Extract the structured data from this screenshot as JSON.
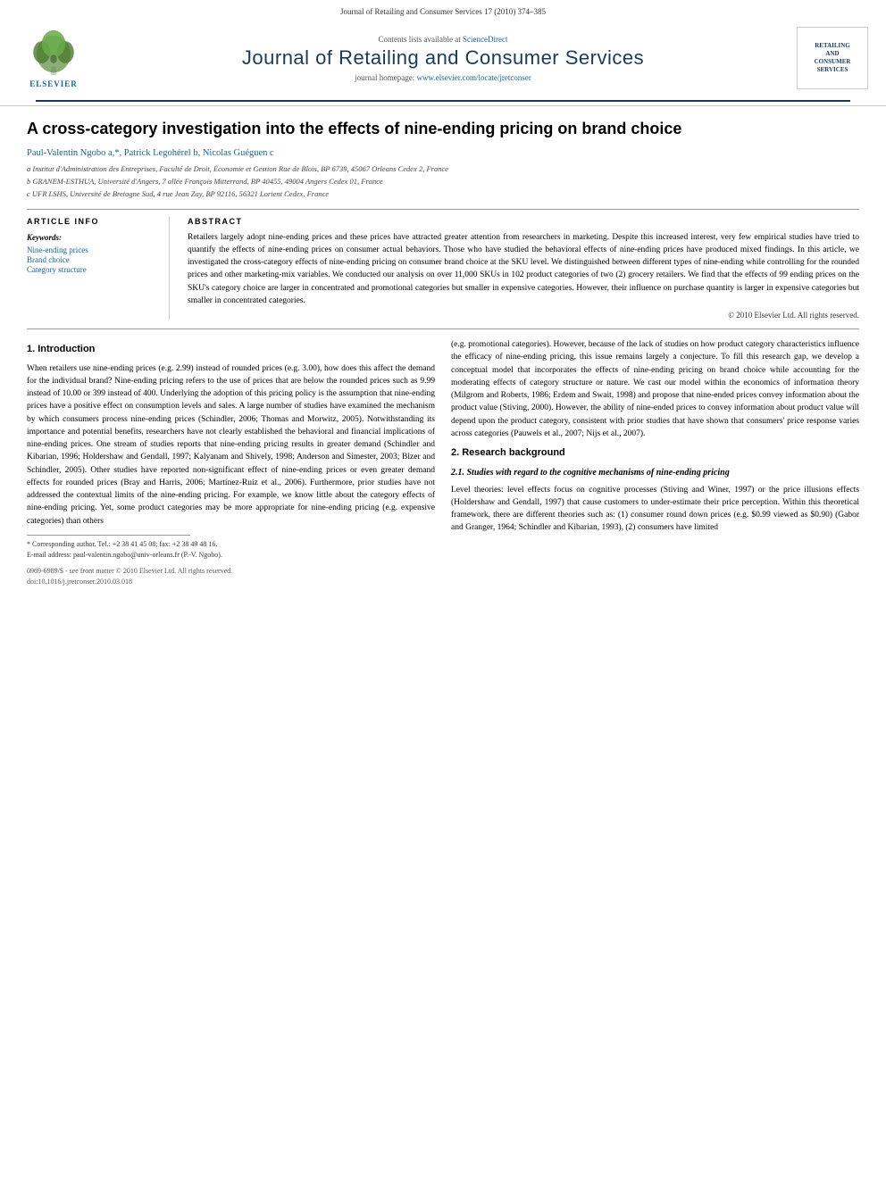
{
  "header": {
    "top_bar": "Journal of Retailing and Consumer Services 17 (2010) 374–385",
    "contents_line": "Contents lists available at",
    "contents_link": "ScienceDirect",
    "journal_name": "Journal of Retailing and Consumer Services",
    "homepage_label": "journal homepage:",
    "homepage_url": "www.elsevier.com/locate/jretconser",
    "elsevier_label": "ELSEVIER",
    "logo_right_lines": [
      "RETAILING",
      "AND",
      "CONSUMER",
      "SERVICES"
    ]
  },
  "article": {
    "title": "A cross-category investigation into the effects of nine-ending pricing on brand choice",
    "authors": "Paul-Valentin Ngobo a,*, Patrick Legohérel b, Nicolas Guéguen c",
    "affiliations": [
      "a Institut d'Administration des Entreprises, Faculté de Droit, Économie et Gestion Rue de Blois, BP 6739, 45067 Orleans Cedex 2, France",
      "b GRANEM-ESTHUA, Université d'Angers, 7 allée François Mitterrand, BP 40455, 49004 Angers Cedex 01, France",
      "c UFR LSHS, Université de Bretagne Sud, 4 rue Jean Zay, BP 92116, 56321 Lorient Cedex, France"
    ],
    "article_info_heading": "ARTICLE INFO",
    "keywords_label": "Keywords:",
    "keywords": [
      "Nine-ending prices",
      "Brand choice",
      "Category structure"
    ],
    "abstract_heading": "ABSTRACT",
    "abstract_text": "Retailers largely adopt nine-ending prices and these prices have attracted greater attention from researchers in marketing. Despite this increased interest, very few empirical studies have tried to quantify the effects of nine-ending prices on consumer actual behaviors. Those who have studied the behavioral effects of nine-ending prices have produced mixed findings. In this article, we investigated the cross-category effects of nine-ending pricing on consumer brand choice at the SKU level. We distinguished between different types of nine-ending while controlling for the rounded prices and other marketing-mix variables. We conducted our analysis on over 11,000 SKUs in 102 product categories of two (2) grocery retailers. We find that the effects of 99 ending prices on the SKU's category choice are larger in concentrated and promotional categories but smaller in expensive categories. However, their influence on purchase quantity is larger in expensive categories but smaller in concentrated categories.",
    "copyright": "© 2010 Elsevier Ltd. All rights reserved."
  },
  "sections": {
    "intro_heading": "1.  Introduction",
    "intro_col1": "When retailers use nine-ending prices (e.g. 2.99) instead of rounded prices (e.g. 3.00), how does this affect the demand for the individual brand? Nine-ending pricing refers to the use of prices that are below the rounded prices such as 9.99 instead of 10.00 or 399 instead of 400. Underlying the adoption of this pricing policy is the assumption that nine-ending prices have a positive effect on consumption levels and sales. A large number of studies have examined the mechanism by which consumers process nine-ending prices (Schindler, 2006; Thomas and Morwitz, 2005). Notwithstanding its importance and potential benefits, researchers have not clearly established the behavioral and financial implications of nine-ending prices. One stream of studies reports that nine-ending pricing results in greater demand (Schindler and Kibarian, 1996; Holdershaw and Gendall, 1997; Kalyanam and Shively, 1998; Anderson and Simester, 2003; Blzer and Schindler, 2005). Other studies have reported non-significant effect of nine-ending prices or even greater demand effects for rounded prices (Bray and Harris, 2006; Martínez-Ruiz et al., 2006). Furthermore, prior studies have not addressed the contextual limits of the nine-ending pricing. For example, we know little about the category effects of nine-ending pricing. Yet, some product categories may be more appropriate for nine-ending pricing (e.g. expensive categories) than others",
    "intro_col2": "(e.g. promotional categories). However, because of the lack of studies on how product category characteristics influence the efficacy of nine-ending pricing, this issue remains largely a conjecture. To fill this research gap, we develop a conceptual model that incorporates the effects of nine-ending pricing on brand choice while accounting for the moderating effects of category structure or nature. We cast our model within the economics of information theory (Milgrom and Roberts, 1986; Erdem and Swait, 1998) and propose that nine-ended prices convey information about the product value (Stiving, 2000). However, the ability of nine-ended prices to convey information about product value will depend upon the product category, consistent with prior studies that have shown that consumers' price response varies across categories (Pauwels et al., 2007; Nijs et al., 2007).",
    "research_bg_heading": "2.  Research background",
    "research_subheading": "2.1. Studies with regard to the cognitive mechanisms of nine-ending pricing",
    "research_col2_text": "Level theories: level effects focus on cognitive processes (Stiving and Winer, 1997) or the price illusions effects (Holdershaw and Gendall, 1997) that cause customers to under-estimate their price perception. Within this theoretical framework, there are different theories such as: (1) consumer round down prices (e.g. $0.99 viewed as $0.90) (Gabor and Granger, 1964; Schindler and Kibarian, 1993), (2) consumers have limited"
  },
  "footnotes": {
    "star_note": "* Corresponding author. Tel.: +2 38 41 45 08; fax: +2 38 49 48 16.",
    "email_note": "E-mail address: paul-valentin.ngobo@univ-orleans.fr (P.-V. Ngobo).",
    "issn_line": "0969-6989/$ - see front matter © 2010 Elsevier Ltd. All rights reserved.",
    "doi_line": "doi:10.1016/j.jretconser.2010.03.018"
  }
}
